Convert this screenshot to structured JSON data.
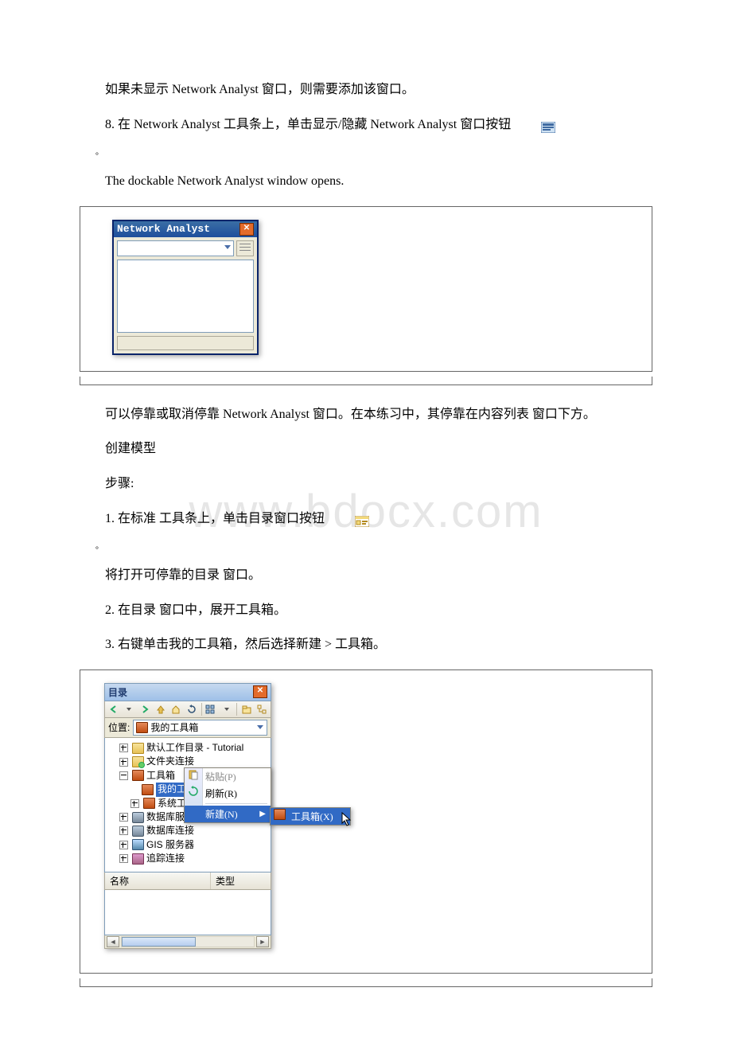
{
  "watermark": "www.bdocx.com",
  "paragraphs": {
    "p1": "如果未显示 Network Analyst 窗口，则需要添加该窗口。",
    "p2_pre": "8. 在 Network Analyst 工具条上，单击显示/隐藏 Network Analyst 窗口按钮",
    "dot": "。",
    "p3": "The dockable Network Analyst window opens.",
    "p4": "可以停靠或取消停靠 Network Analyst 窗口。在本练习中，其停靠在内容列表 窗口下方。",
    "p5": "创建模型",
    "p6": "步骤:",
    "p7_pre": "1. 在标准 工具条上，单击目录窗口按钮",
    "p8": "将打开可停靠的目录 窗口。",
    "p9": "2. 在目录 窗口中，展开工具箱。",
    "p10": "3. 右键单击我的工具箱，然后选择新建 > 工具箱。"
  },
  "na_window": {
    "title": "Network Analyst"
  },
  "catalog": {
    "title": "目录",
    "location_label": "位置:",
    "location_value": "我的工具箱",
    "tree": {
      "default_dir": "默认工作目录 - Tutorial",
      "folder_conn": "文件夹连接",
      "toolboxes": "工具箱",
      "my_toolbox": "我的工具",
      "system_tool": "系统工",
      "db_servers": "数据库服务",
      "db_conn": "数据库连接",
      "gis_servers": "GIS 服务器",
      "tracking": "追踪连接"
    },
    "ctx": {
      "paste": "粘贴(P)",
      "refresh": "刷新(R)",
      "new": "新建(N)"
    },
    "submenu": {
      "toolbox": "工具箱(X)"
    },
    "columns": {
      "name": "名称",
      "type": "类型"
    }
  }
}
